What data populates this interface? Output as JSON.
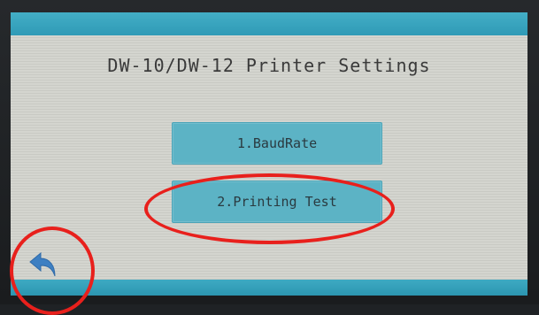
{
  "screen": {
    "title": "DW-10/DW-12 Printer Settings",
    "accent_color": "#3aa5bf"
  },
  "menu": {
    "items": [
      {
        "label": "1.BaudRate"
      },
      {
        "label": "2.Printing Test"
      }
    ]
  },
  "nav": {
    "back_icon": "back-arrow-icon"
  },
  "annotations": {
    "color": "#e8201c",
    "highlighted": [
      "2.Printing Test",
      "back-button"
    ]
  }
}
